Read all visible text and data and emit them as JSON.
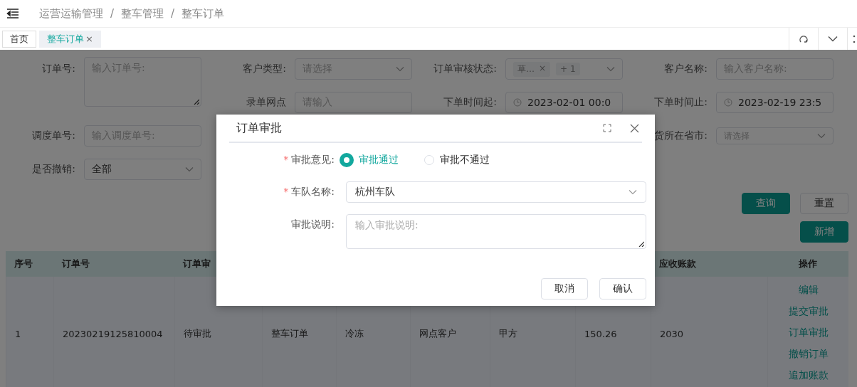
{
  "breadcrumb": {
    "items": [
      "运营运输管理",
      "整车管理",
      "整车订单"
    ],
    "separators": [
      "/",
      "/"
    ]
  },
  "tabs": [
    {
      "label": "首页",
      "selected": false
    },
    {
      "label": "整车订单",
      "selected": true,
      "close": "×"
    }
  ],
  "filter_columns": [
    [
      {
        "kind": "textarea",
        "label": "订单号:",
        "placeholder": "输入订单号:"
      },
      {
        "kind": "input",
        "label": "调度单号:",
        "placeholder": "输入调度单号:"
      },
      {
        "kind": "select",
        "label": "是否撤销:",
        "value": "全部"
      }
    ],
    [
      {
        "kind": "select",
        "label": "客户类型:",
        "placeholder": "请选择"
      },
      {
        "kind": "input",
        "label": "录单网点",
        "placeholder": "请输入"
      }
    ],
    [
      {
        "kind": "tags",
        "label": "订单审核状态:",
        "tags": [
          {
            "text": "草…",
            "close": "×"
          },
          {
            "text": "+ 1"
          }
        ]
      },
      {
        "kind": "date",
        "label": "下单时间起:",
        "value": "2023-02-01 00:0"
      }
    ],
    [
      {
        "kind": "input",
        "label": "客户名称:",
        "placeholder": "输入客户名称:"
      },
      {
        "kind": "date",
        "label": "下单时间止:",
        "value": "2023-02-19 23:5"
      },
      {
        "kind": "select",
        "label": "货所在省市:",
        "placeholder": "请选择",
        "small": true
      }
    ]
  ],
  "search_buttons": [
    {
      "label": "查询",
      "kind": "primary"
    },
    {
      "label": "重置",
      "kind": "default"
    }
  ],
  "add_button": {
    "label": "新增"
  },
  "table": {
    "columns": [
      "序号",
      "订单号",
      "订单审",
      null,
      null,
      null,
      null,
      null,
      "应收账款",
      "操作"
    ],
    "rows": [
      {
        "cells": [
          "1",
          "20230219125810004",
          "待审批",
          "整车订单",
          "冷冻",
          "网点客户",
          "甲方",
          "150.26",
          "2030"
        ],
        "actions": [
          "编辑",
          "提交审批",
          "订单审批",
          "撤销订单",
          "追加账款"
        ]
      }
    ]
  },
  "dialog": {
    "title": "订单审批",
    "fields": [
      {
        "kind": "radio",
        "label": "审批意见:",
        "required_mark": "*",
        "options": [
          {
            "label": "审批通过",
            "selected": true
          },
          {
            "label": "审批不通过",
            "selected": false
          }
        ]
      },
      {
        "kind": "select",
        "label": "车队名称:",
        "required_mark": "*",
        "value": "杭州车队"
      },
      {
        "kind": "textarea",
        "label": "审批说明:",
        "placeholder": "输入审批说明:"
      }
    ],
    "buttons": [
      "取消",
      "确认"
    ]
  }
}
